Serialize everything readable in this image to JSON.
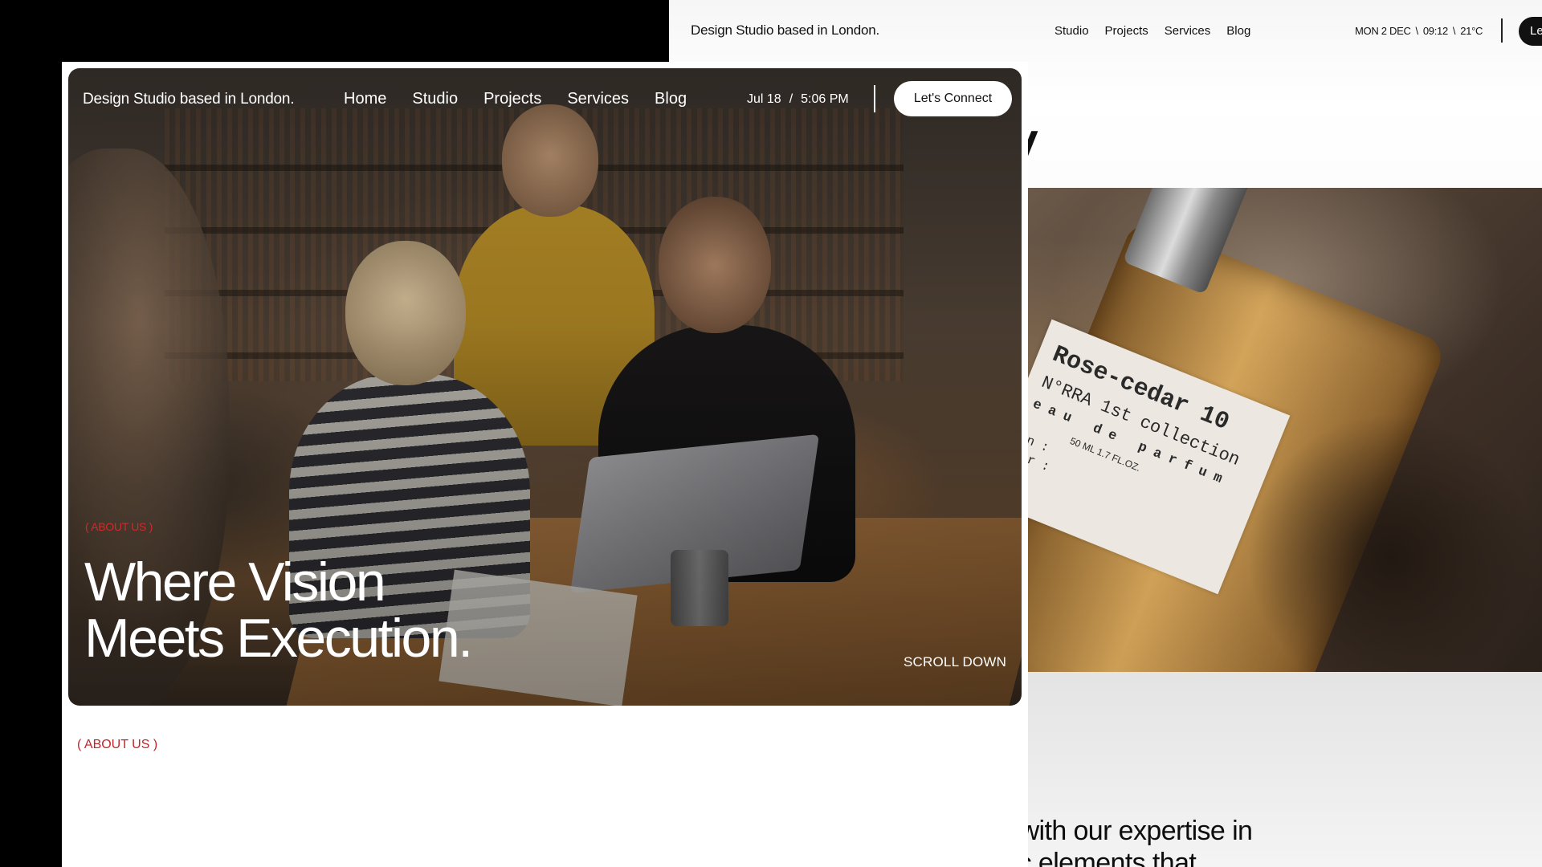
{
  "back_window": {
    "tagline": "Design Studio based in London.",
    "nav": [
      "Studio",
      "Projects",
      "Services",
      "Blog"
    ],
    "meta": {
      "date": "MON 2 DEC",
      "sep1": "\\",
      "time": "09:12",
      "sep2": "\\",
      "temp": "21°C"
    },
    "connect_label": "Le",
    "hero_glyph": "/",
    "perfume_label": {
      "title": "Rose-cedar 10",
      "collection": "N°RRA 1st collection",
      "type": "eau de parfum",
      "volume": "50 ML 1.7 FL.OZ.",
      "on": "On  :",
      "for": "For :"
    },
    "body_line1": "brand identity with our expertise in",
    "body_line2": "ls and strategic elements that"
  },
  "front_window": {
    "tagline": "Design Studio based in London.",
    "nav": [
      "Home",
      "Studio",
      "Projects",
      "Services",
      "Blog"
    ],
    "meta": {
      "date": "Jul 18",
      "sep": "/",
      "time": "5:06 PM"
    },
    "connect_label": "Let's Connect",
    "hero": {
      "eyebrow": "( ABOUT US )",
      "heading_line1": "Where Vision",
      "heading_line2": "Meets Execution.",
      "scroll_label": "SCROLL DOWN"
    },
    "about_label": "( ABOUT US )"
  },
  "colors": {
    "accent_red": "#c0262a",
    "button_bg": "#ffffff",
    "dark_button_bg": "#111111"
  }
}
